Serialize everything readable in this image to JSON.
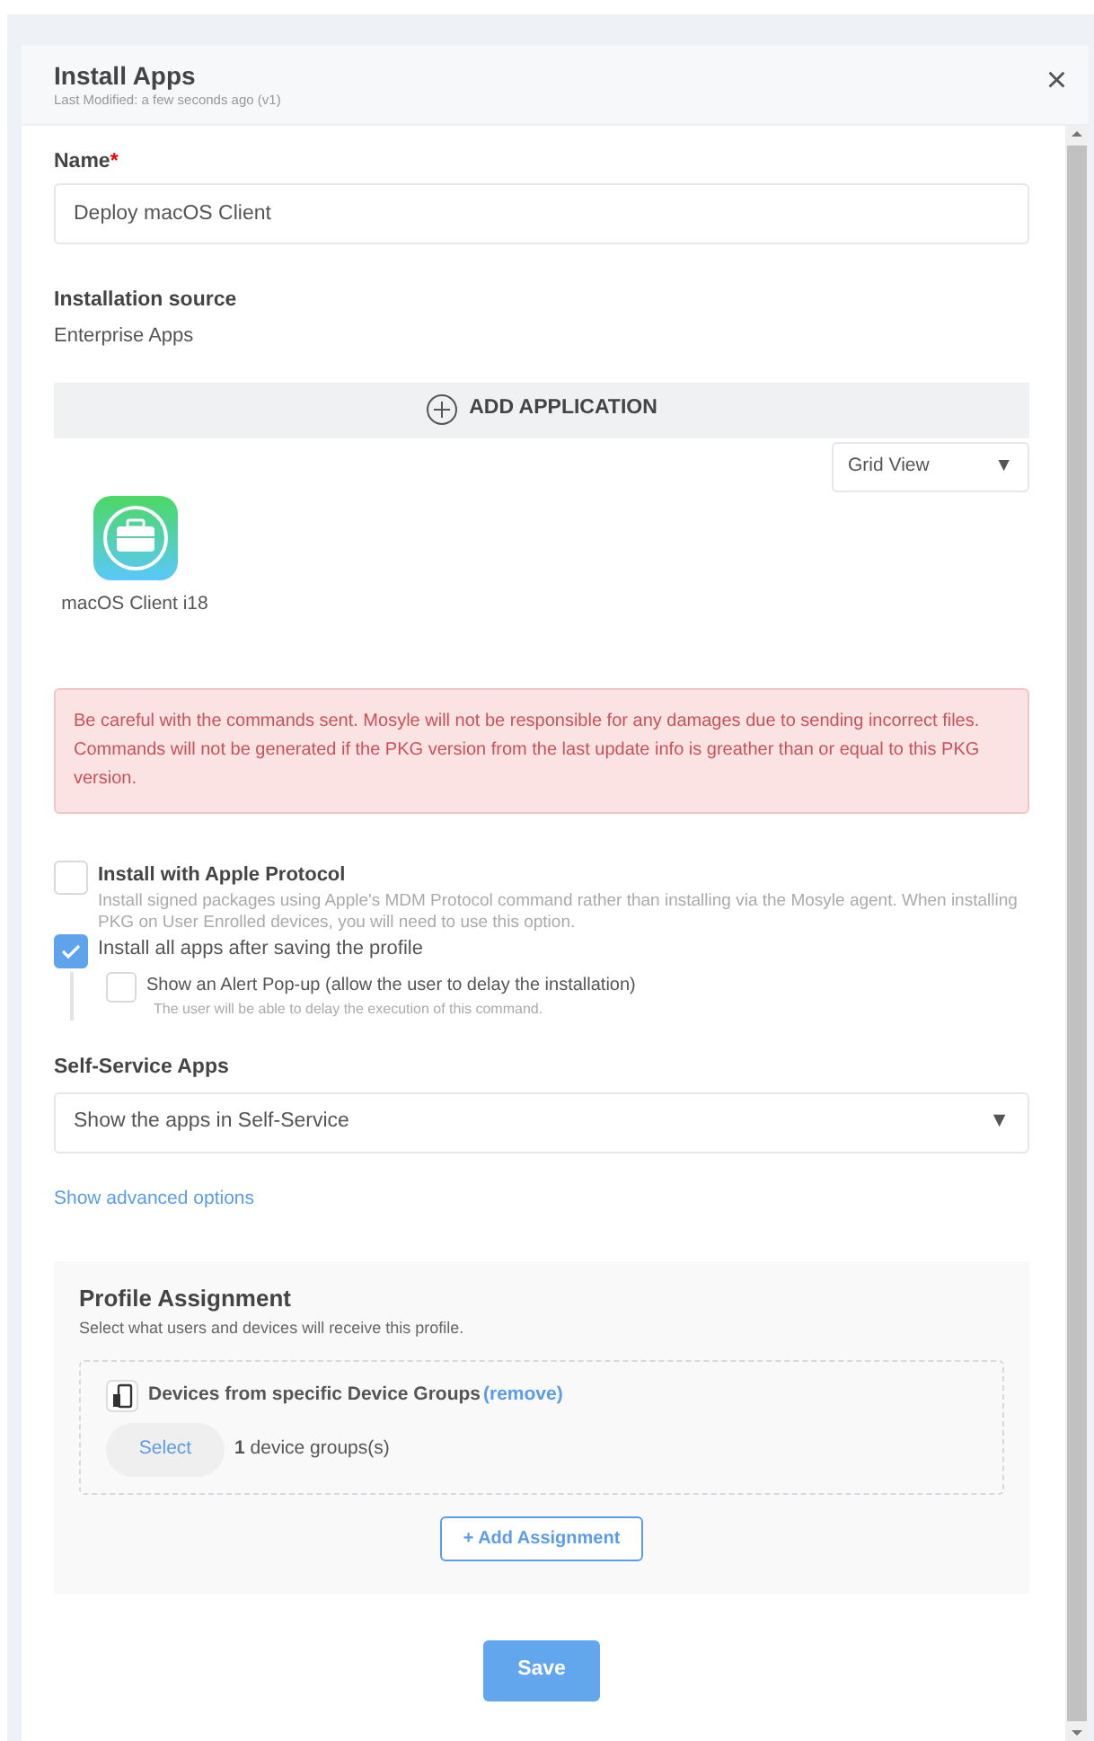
{
  "modal": {
    "title": "Install Apps",
    "subtitle": "Last Modified: a few seconds ago (v1)",
    "close": "×"
  },
  "name_field": {
    "label": "Name",
    "required_mark": "*",
    "value": "Deploy macOS Client"
  },
  "installation_source": {
    "label": "Installation source",
    "value": "Enterprise Apps"
  },
  "add_application": {
    "label": "ADD APPLICATION"
  },
  "view_select": {
    "value": "Grid View",
    "arrow": "▼"
  },
  "apps": [
    {
      "name": "macOS Client i18"
    }
  ],
  "alert": {
    "text": "Be careful with the commands sent. Mosyle will not be responsible for any damages due to sending incorrect files. Commands will not be generated if the PKG version from the last update info is greather than or equal to this PKG version."
  },
  "options": [
    {
      "kind": "titled",
      "label": "Install with Apple Protocol",
      "description": "Install signed packages using Apple's MDM Protocol command rather than installing via the Mosyle agent. When installing PKG on User Enrolled devices, you will need to use this option.",
      "checked": false
    },
    {
      "kind": "plain",
      "label": "Install all apps after saving the profile",
      "checked": true,
      "children": [
        {
          "label": "Show an Alert Pop-up (allow the user to delay the installation)",
          "description": "The user will be able to delay the execution of this command.",
          "checked": false
        }
      ]
    }
  ],
  "self_service": {
    "label": "Self-Service Apps",
    "value": "Show the apps in Self-Service",
    "arrow": "▼"
  },
  "advanced_link": "Show advanced options",
  "profile_assignment": {
    "title": "Profile Assignment",
    "subtitle": "Select what users and devices will receive this profile.",
    "assignments": [
      {
        "label": "Devices from specific Device Groups",
        "remove": "(remove)",
        "select": "Select",
        "count": "**1** device groups(s)"
      }
    ],
    "add_button": "+ Add Assignment"
  },
  "save": "Save"
}
